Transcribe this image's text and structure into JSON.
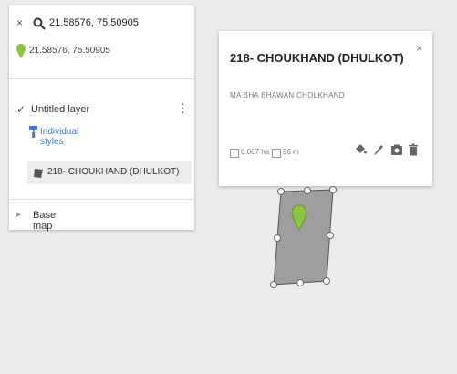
{
  "search": {
    "query": "21.58576, 75.50905",
    "close_glyph": "×"
  },
  "coordinates": "21.58576, 75.50905",
  "layer": {
    "title": "Untitled layer",
    "check_glyph": "✓",
    "more_glyph": "⋮",
    "styles_label": "Individual styles",
    "feature_label": "218- CHOUKHAND (DHULKOT)"
  },
  "basemap": {
    "label": "Base map",
    "icon_glyph": "▸"
  },
  "card": {
    "title": "218- CHOUKHAND (DHULKOT)",
    "close_glyph": "×",
    "description": "MA BHA BHAWAN CHOLKHAND",
    "area": "0.067 ha",
    "perimeter": "96 m"
  },
  "icons": {
    "search": "search-icon",
    "pin": "green-pin-icon",
    "styles": "paint-roller-icon",
    "feature": "polygon-icon",
    "paint": "paint-bucket-icon",
    "edit": "pencil-icon",
    "photo": "camera-icon",
    "delete": "trash-icon"
  },
  "colors": {
    "pin": "#8bc53f",
    "link": "#3a78d8",
    "polygon_fill": "#9e9e9e"
  }
}
